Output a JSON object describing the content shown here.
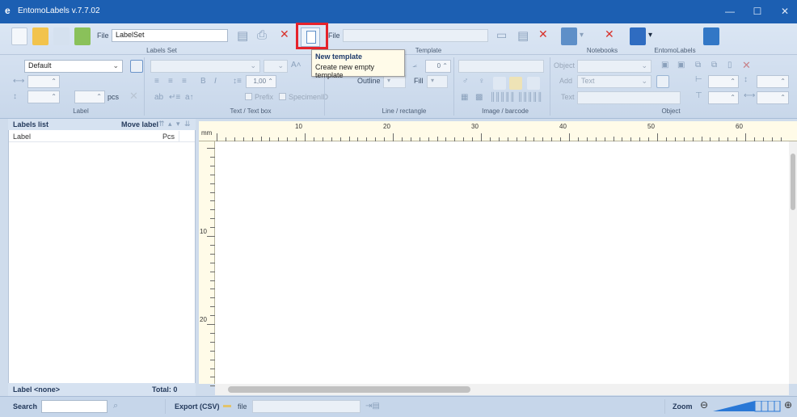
{
  "window": {
    "title": "EntomoLabels v.7.7.02",
    "minimize": "—",
    "maximize": "☐",
    "close": "✕"
  },
  "ribbon": {
    "labels_set": {
      "file_label": "File",
      "file_value": "LabelSet",
      "group_label": "Labels Set"
    },
    "template": {
      "file_label": "File",
      "file_value": "",
      "group_label": "Template"
    },
    "notebooks": {
      "group_label": "Notebooks"
    },
    "entomolabels": {
      "group_label": "EntomoLabels"
    },
    "label_group": {
      "preset_value": "Default",
      "pcs_label": "pcs",
      "group_label": "Label"
    },
    "textbox_group": {
      "letter_spacing_value": "1,00",
      "prefix_label": "Prefix",
      "specimen_label": "SpecimenID",
      "group_label": "Text / Text box"
    },
    "line_group": {
      "angle_value": "0",
      "outline_label": "Outline",
      "fill_label": "Fill",
      "group_label": "Line / rectangle"
    },
    "image_group": {
      "group_label": "Image / barcode"
    },
    "object_group": {
      "object_label": "Object",
      "add_label": "Add",
      "add_value": "Text",
      "text_label": "Text",
      "group_label": "Object"
    }
  },
  "tooltip": {
    "title": "New template",
    "description": "Create new empty template"
  },
  "labels_list": {
    "title": "Labels list",
    "move_label": "Move label",
    "col_label": "Label",
    "col_pcs": "Pcs",
    "footer_label": "Label <none>",
    "footer_total": "Total: 0"
  },
  "ruler": {
    "unit": "mm",
    "top_ticks": [
      "10",
      "20",
      "30",
      "40",
      "50",
      "60"
    ],
    "left_ticks": [
      "10",
      "20"
    ]
  },
  "statusbar": {
    "search_label": "Search",
    "search_value": "",
    "export_label": "Export (CSV)",
    "file_label": "file",
    "file_value": "",
    "zoom_label": "Zoom"
  },
  "colors": {
    "titlebar": "#1c5fb2",
    "ribbon": "#dbe6f4",
    "accent_red": "#d8322b",
    "highlight": "#e5222b"
  }
}
